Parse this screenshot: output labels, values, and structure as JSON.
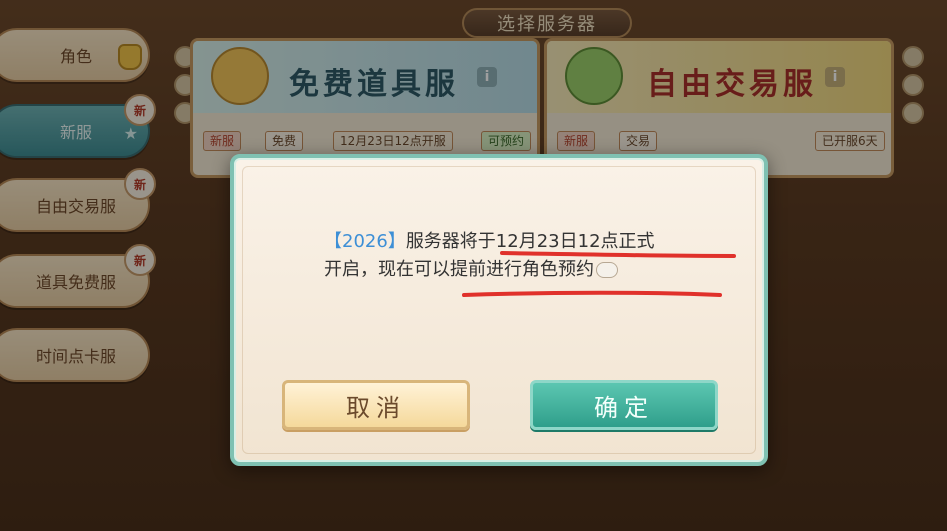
{
  "header": {
    "title": "选择服务器"
  },
  "sidebar": {
    "items": [
      {
        "label": "角色",
        "active": false,
        "badge": ""
      },
      {
        "label": "新服",
        "active": true,
        "badge": "新"
      },
      {
        "label": "自由交易服",
        "active": false,
        "badge": "新"
      },
      {
        "label": "道具免费服",
        "active": false,
        "badge": "新"
      },
      {
        "label": "时间点卡服",
        "active": false,
        "badge": ""
      }
    ]
  },
  "cards": {
    "free": {
      "title": "免费道具服",
      "info_icon": "i",
      "tag_new": "新服",
      "tag_type": "免费",
      "tag_time": "12月23日12点开服",
      "tag_status": "可预约"
    },
    "trade": {
      "title": "自由交易服",
      "info_icon": "i",
      "tag_new": "新服",
      "tag_type": "交易",
      "tag_status": "已开服6天"
    }
  },
  "dialog": {
    "year_tag": "【2026】",
    "line1_text": "服务器将于12月23日12点正式",
    "line2_text": "开启，现在可以提前进行角色预约",
    "cancel_label": "取消",
    "confirm_label": "确定"
  },
  "colors": {
    "accent_teal": "#2f9f8b",
    "year_blue": "#3d8fd6",
    "underline_red": "#e0312b"
  }
}
